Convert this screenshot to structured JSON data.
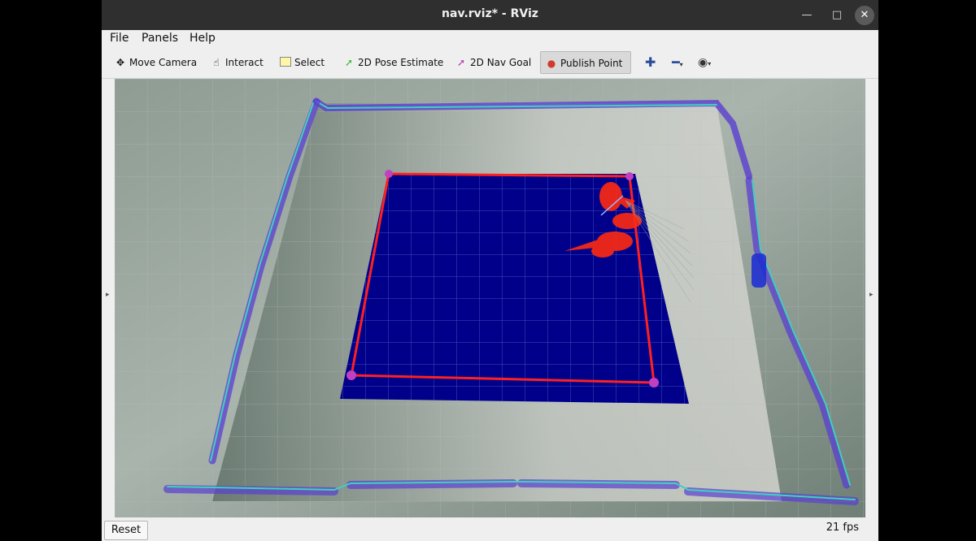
{
  "window": {
    "title": "nav.rviz* - RViz",
    "controls": {
      "minimize": "—",
      "maximize": "□",
      "close": "✕"
    }
  },
  "menu": {
    "file": "File",
    "panels": "Panels",
    "help": "Help"
  },
  "toolbar": {
    "move_camera": "Move Camera",
    "interact": "Interact",
    "select": "Select",
    "pose_estimate": "2D Pose Estimate",
    "nav_goal": "2D Nav Goal",
    "publish_point": "Publish Point",
    "icons": {
      "move_camera": "move-camera-icon",
      "interact": "hand-icon",
      "select": "select-box-icon",
      "pose_estimate": "green-arrow-icon",
      "nav_goal": "purple-arrow-icon",
      "publish_point": "map-pin-icon",
      "add": "plus-icon",
      "remove": "minus-icon",
      "camera": "eye-icon"
    }
  },
  "status": {
    "reset": "Reset",
    "fps": "21 fps"
  },
  "colors": {
    "titlebar": "#2f2f2f",
    "costmap": "#00008b",
    "footprint": "#ff2020",
    "corner_marker": "#c040c0",
    "obstacle": "#5a3fd0",
    "inflation": "#40d0c0"
  }
}
